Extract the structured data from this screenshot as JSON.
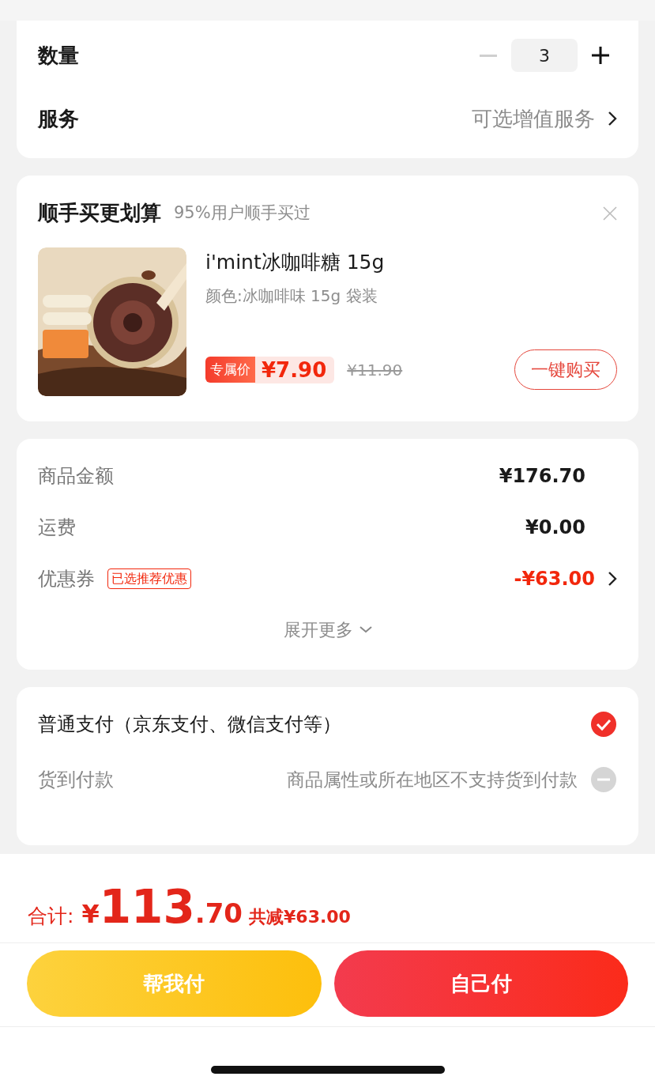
{
  "quantity": {
    "label": "数量",
    "value": "3",
    "decrease_disabled": true
  },
  "service": {
    "label": "服务",
    "value": "可选增值服务"
  },
  "addon": {
    "title": "顺手买更划算",
    "subtitle": "95%用户顺手买过",
    "product": {
      "kind": "picture",
      "name": "i'mint冰咖啡糖 15g",
      "spec": "颜色:冰咖啡味 15g 袋装",
      "price_tag": "专属价",
      "price": "¥7.90",
      "original_price": "¥11.90",
      "button": "一键购买"
    }
  },
  "fees": [
    {
      "label": "商品金额",
      "value": "¥176.70",
      "kind": "plain"
    },
    {
      "label": "运费",
      "value": "¥0.00",
      "kind": "plain"
    },
    {
      "label": "优惠券",
      "tag": "已选推荐优惠",
      "value": "-¥63.00",
      "kind": "discount"
    }
  ],
  "fees_more": "展开更多",
  "payments": [
    {
      "label": "普通支付（京东支付、微信支付等）",
      "selected": true,
      "disabled": false
    },
    {
      "label": "货到付款",
      "note": "商品属性或所在地区不支持货到付款",
      "selected": false,
      "disabled": true
    }
  ],
  "total": {
    "label": "合计:",
    "currency": "¥",
    "integer": "113",
    "decimal": ".70",
    "saving": "共减¥63.00"
  },
  "buttons": [
    {
      "label": "帮我付",
      "kind": "secondary"
    },
    {
      "label": "自己付",
      "kind": "primary"
    }
  ]
}
